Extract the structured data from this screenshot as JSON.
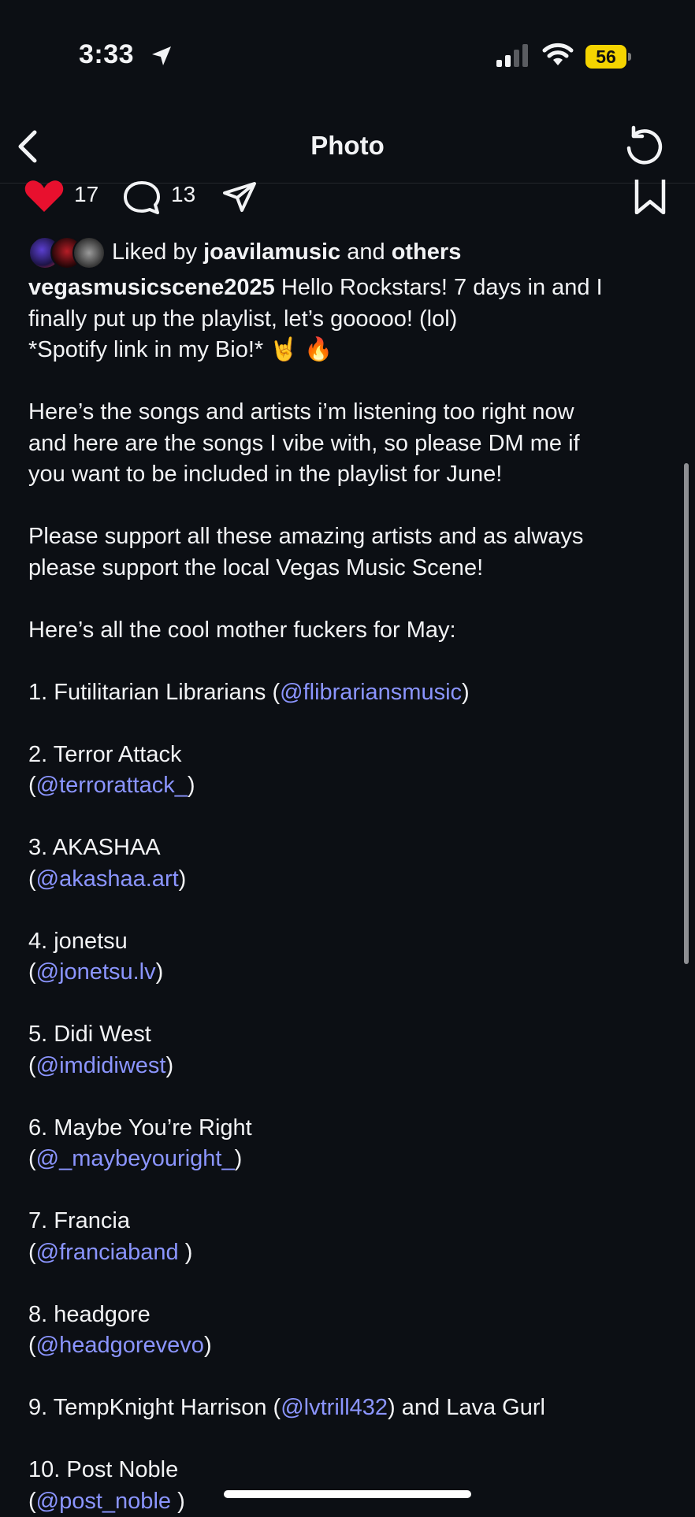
{
  "status_bar": {
    "time": "3:33",
    "battery": "56"
  },
  "nav": {
    "title": "Photo"
  },
  "actions": {
    "likes": "17",
    "comments": "13"
  },
  "liked_by": {
    "prefix": "Liked by",
    "user": "joavilamusic",
    "joiner": "and",
    "others": "others"
  },
  "caption": {
    "username": "vegasmusicscene2025",
    "lines": [
      [
        {
          "t": " Hello Rockstars! 7 days in and I"
        }
      ],
      [
        {
          "t": "finally put up the playlist, let’s gooooo! (lol)"
        }
      ],
      [
        {
          "t": "*Spotify link in my Bio!* 🤘 🔥"
        }
      ],
      [],
      [
        {
          "t": "Here’s the songs and artists i’m listening too right now"
        }
      ],
      [
        {
          "t": "and here are the songs I vibe with, so please DM me if"
        }
      ],
      [
        {
          "t": "you want to be included in the playlist for June!"
        }
      ],
      [],
      [
        {
          "t": "Please support all these amazing artists and as always"
        }
      ],
      [
        {
          "t": "please support the local Vegas Music Scene!"
        }
      ],
      [],
      [
        {
          "t": "Here’s all the cool mother fuckers for May:"
        }
      ],
      [],
      [
        {
          "t": "1. Futilitarian Librarians ("
        },
        {
          "t": "@flibrariansmusic",
          "m": true
        },
        {
          "t": ")"
        }
      ],
      [],
      [
        {
          "t": "2. Terror Attack"
        }
      ],
      [
        {
          "t": "("
        },
        {
          "t": "@terrorattack_",
          "m": true
        },
        {
          "t": ")"
        }
      ],
      [],
      [
        {
          "t": "3. AKASHAA"
        }
      ],
      [
        {
          "t": "("
        },
        {
          "t": "@akashaa.art",
          "m": true
        },
        {
          "t": ")"
        }
      ],
      [],
      [
        {
          "t": "4. jonetsu"
        }
      ],
      [
        {
          "t": "("
        },
        {
          "t": "@jonetsu.lv",
          "m": true
        },
        {
          "t": ")"
        }
      ],
      [],
      [
        {
          "t": "5. Didi West"
        }
      ],
      [
        {
          "t": "("
        },
        {
          "t": "@imdidiwest",
          "m": true
        },
        {
          "t": ")"
        }
      ],
      [],
      [
        {
          "t": "6. Maybe You’re Right"
        }
      ],
      [
        {
          "t": "("
        },
        {
          "t": "@_maybeyouright_",
          "m": true
        },
        {
          "t": ")"
        }
      ],
      [],
      [
        {
          "t": "7. Francia"
        }
      ],
      [
        {
          "t": "("
        },
        {
          "t": "@franciaband",
          "m": true
        },
        {
          "t": " )"
        }
      ],
      [],
      [
        {
          "t": "8. headgore"
        }
      ],
      [
        {
          "t": "("
        },
        {
          "t": "@headgorevevo",
          "m": true
        },
        {
          "t": ")"
        }
      ],
      [],
      [
        {
          "t": "9. TempKnight Harrison ("
        },
        {
          "t": "@lvtrill432",
          "m": true
        },
        {
          "t": ") and Lava Gurl"
        }
      ],
      [],
      [
        {
          "t": "10. Post Noble"
        }
      ],
      [
        {
          "t": "("
        },
        {
          "t": "@post_noble",
          "m": true
        },
        {
          "t": " )"
        }
      ]
    ]
  },
  "colors": {
    "background": "#0c0f14",
    "mention": "#8b95ff",
    "heart": "#e8102e",
    "battery": "#f5d400"
  },
  "icons": [
    "back-chevron-icon",
    "refresh-icon",
    "heart-icon",
    "comment-icon",
    "share-icon",
    "bookmark-icon",
    "location-arrow-icon",
    "signal-icon",
    "wifi-icon",
    "battery-icon"
  ]
}
